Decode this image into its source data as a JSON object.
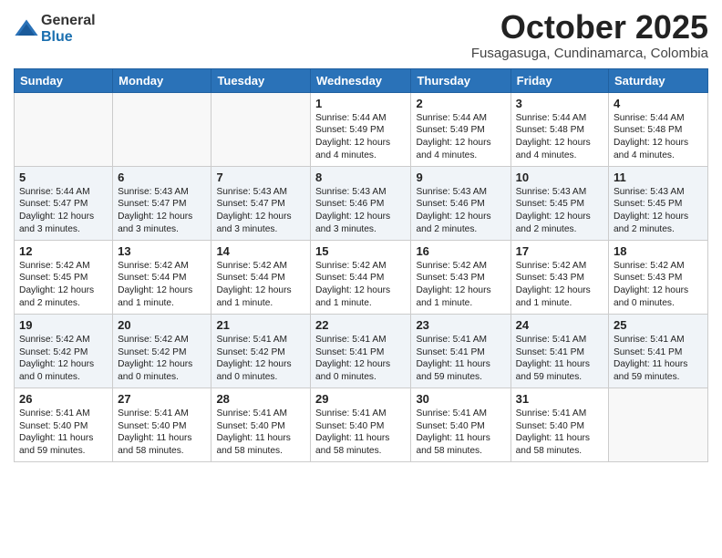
{
  "header": {
    "logo_general": "General",
    "logo_blue": "Blue",
    "month": "October 2025",
    "location": "Fusagasuga, Cundinamarca, Colombia"
  },
  "weekdays": [
    "Sunday",
    "Monday",
    "Tuesday",
    "Wednesday",
    "Thursday",
    "Friday",
    "Saturday"
  ],
  "weeks": [
    [
      {
        "day": "",
        "content": ""
      },
      {
        "day": "",
        "content": ""
      },
      {
        "day": "",
        "content": ""
      },
      {
        "day": "1",
        "content": "Sunrise: 5:44 AM\nSunset: 5:49 PM\nDaylight: 12 hours\nand 4 minutes."
      },
      {
        "day": "2",
        "content": "Sunrise: 5:44 AM\nSunset: 5:49 PM\nDaylight: 12 hours\nand 4 minutes."
      },
      {
        "day": "3",
        "content": "Sunrise: 5:44 AM\nSunset: 5:48 PM\nDaylight: 12 hours\nand 4 minutes."
      },
      {
        "day": "4",
        "content": "Sunrise: 5:44 AM\nSunset: 5:48 PM\nDaylight: 12 hours\nand 4 minutes."
      }
    ],
    [
      {
        "day": "5",
        "content": "Sunrise: 5:44 AM\nSunset: 5:47 PM\nDaylight: 12 hours\nand 3 minutes."
      },
      {
        "day": "6",
        "content": "Sunrise: 5:43 AM\nSunset: 5:47 PM\nDaylight: 12 hours\nand 3 minutes."
      },
      {
        "day": "7",
        "content": "Sunrise: 5:43 AM\nSunset: 5:47 PM\nDaylight: 12 hours\nand 3 minutes."
      },
      {
        "day": "8",
        "content": "Sunrise: 5:43 AM\nSunset: 5:46 PM\nDaylight: 12 hours\nand 3 minutes."
      },
      {
        "day": "9",
        "content": "Sunrise: 5:43 AM\nSunset: 5:46 PM\nDaylight: 12 hours\nand 2 minutes."
      },
      {
        "day": "10",
        "content": "Sunrise: 5:43 AM\nSunset: 5:45 PM\nDaylight: 12 hours\nand 2 minutes."
      },
      {
        "day": "11",
        "content": "Sunrise: 5:43 AM\nSunset: 5:45 PM\nDaylight: 12 hours\nand 2 minutes."
      }
    ],
    [
      {
        "day": "12",
        "content": "Sunrise: 5:42 AM\nSunset: 5:45 PM\nDaylight: 12 hours\nand 2 minutes."
      },
      {
        "day": "13",
        "content": "Sunrise: 5:42 AM\nSunset: 5:44 PM\nDaylight: 12 hours\nand 1 minute."
      },
      {
        "day": "14",
        "content": "Sunrise: 5:42 AM\nSunset: 5:44 PM\nDaylight: 12 hours\nand 1 minute."
      },
      {
        "day": "15",
        "content": "Sunrise: 5:42 AM\nSunset: 5:44 PM\nDaylight: 12 hours\nand 1 minute."
      },
      {
        "day": "16",
        "content": "Sunrise: 5:42 AM\nSunset: 5:43 PM\nDaylight: 12 hours\nand 1 minute."
      },
      {
        "day": "17",
        "content": "Sunrise: 5:42 AM\nSunset: 5:43 PM\nDaylight: 12 hours\nand 1 minute."
      },
      {
        "day": "18",
        "content": "Sunrise: 5:42 AM\nSunset: 5:43 PM\nDaylight: 12 hours\nand 0 minutes."
      }
    ],
    [
      {
        "day": "19",
        "content": "Sunrise: 5:42 AM\nSunset: 5:42 PM\nDaylight: 12 hours\nand 0 minutes."
      },
      {
        "day": "20",
        "content": "Sunrise: 5:42 AM\nSunset: 5:42 PM\nDaylight: 12 hours\nand 0 minutes."
      },
      {
        "day": "21",
        "content": "Sunrise: 5:41 AM\nSunset: 5:42 PM\nDaylight: 12 hours\nand 0 minutes."
      },
      {
        "day": "22",
        "content": "Sunrise: 5:41 AM\nSunset: 5:41 PM\nDaylight: 12 hours\nand 0 minutes."
      },
      {
        "day": "23",
        "content": "Sunrise: 5:41 AM\nSunset: 5:41 PM\nDaylight: 11 hours\nand 59 minutes."
      },
      {
        "day": "24",
        "content": "Sunrise: 5:41 AM\nSunset: 5:41 PM\nDaylight: 11 hours\nand 59 minutes."
      },
      {
        "day": "25",
        "content": "Sunrise: 5:41 AM\nSunset: 5:41 PM\nDaylight: 11 hours\nand 59 minutes."
      }
    ],
    [
      {
        "day": "26",
        "content": "Sunrise: 5:41 AM\nSunset: 5:40 PM\nDaylight: 11 hours\nand 59 minutes."
      },
      {
        "day": "27",
        "content": "Sunrise: 5:41 AM\nSunset: 5:40 PM\nDaylight: 11 hours\nand 58 minutes."
      },
      {
        "day": "28",
        "content": "Sunrise: 5:41 AM\nSunset: 5:40 PM\nDaylight: 11 hours\nand 58 minutes."
      },
      {
        "day": "29",
        "content": "Sunrise: 5:41 AM\nSunset: 5:40 PM\nDaylight: 11 hours\nand 58 minutes."
      },
      {
        "day": "30",
        "content": "Sunrise: 5:41 AM\nSunset: 5:40 PM\nDaylight: 11 hours\nand 58 minutes."
      },
      {
        "day": "31",
        "content": "Sunrise: 5:41 AM\nSunset: 5:40 PM\nDaylight: 11 hours\nand 58 minutes."
      },
      {
        "day": "",
        "content": ""
      }
    ]
  ]
}
